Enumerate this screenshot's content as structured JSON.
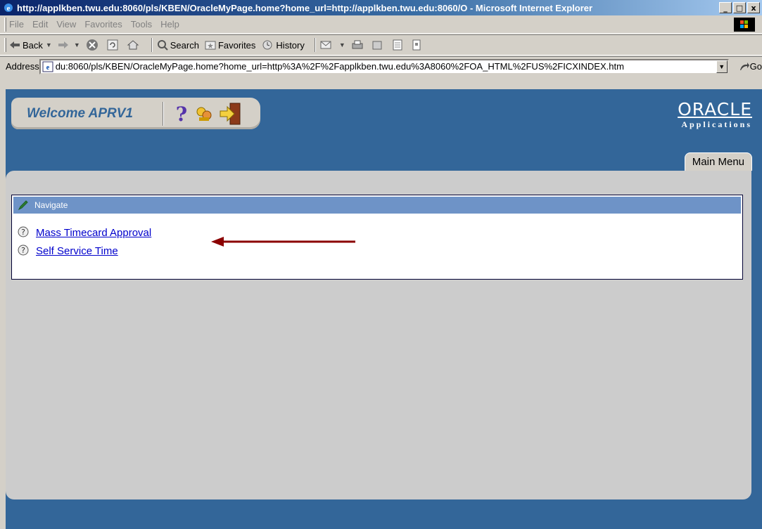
{
  "window": {
    "title": "http://applkben.twu.edu:8060/pls/KBEN/OracleMyPage.home?home_url=http://applkben.twu.edu:8060/O - Microsoft Internet Explorer",
    "controls": [
      "_",
      "□",
      "x"
    ]
  },
  "menubar": {
    "items": [
      "File",
      "Edit",
      "View",
      "Favorites",
      "Tools",
      "Help"
    ]
  },
  "toolbar": {
    "back": "Back",
    "search": "Search",
    "favorites": "Favorites",
    "history": "History"
  },
  "address": {
    "label": "Address",
    "url": "du:8060/pls/KBEN/OracleMyPage.home?home_url=http%3A%2F%2Fapplkben.twu.edu%3A8060%2FOA_HTML%2FUS%2FICXINDEX.htm",
    "go": "Go"
  },
  "app": {
    "welcome": "Welcome APRV1",
    "logo_name": "ORACLE",
    "logo_sub": "Applications",
    "tab": "Main Menu"
  },
  "navigate": {
    "header": "Navigate",
    "links": [
      "Mass Timecard Approval",
      "Self Service Time"
    ]
  },
  "colors": {
    "banner": "#336699",
    "panel": "#cccccc",
    "header_bar": "#6e93c7",
    "link": "#0000cc",
    "arrow": "#8b0000"
  }
}
